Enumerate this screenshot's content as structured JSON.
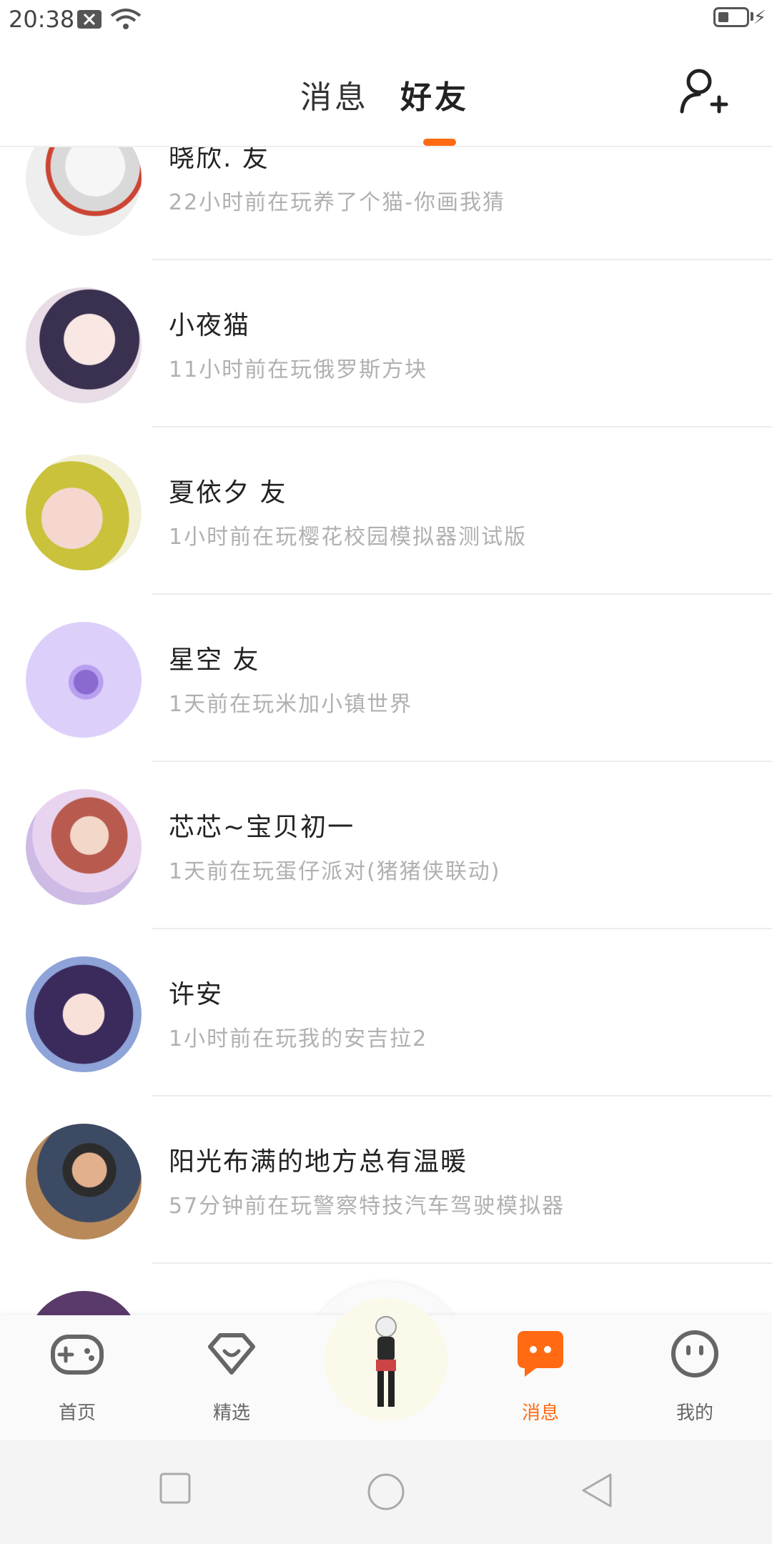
{
  "status_bar": {
    "time": "20:38"
  },
  "header": {
    "tabs": [
      {
        "label": "消息"
      },
      {
        "label": "好友"
      }
    ]
  },
  "friends": [
    {
      "name": "晓欣. 友",
      "status": "22小时前在玩养了个猫-你画我猜"
    },
    {
      "name": "小夜猫",
      "status": "11小时前在玩俄罗斯方块"
    },
    {
      "name": "夏依夕 友",
      "status": "1小时前在玩樱花校园模拟器测试版"
    },
    {
      "name": "星空 友",
      "status": "1天前在玩米加小镇世界"
    },
    {
      "name": "芯芯~宝贝初一",
      "status": "1天前在玩蛋仔派对(猪猪侠联动)"
    },
    {
      "name": "许安",
      "status": "1小时前在玩我的安吉拉2"
    },
    {
      "name": "阳光布满的地方总有温暖",
      "status": "57分钟前在玩警察特技汽车驾驶模拟器"
    },
    {
      "name": "",
      "status": ""
    }
  ],
  "bottom_nav": {
    "items": [
      {
        "label": "首页"
      },
      {
        "label": "精选"
      },
      {
        "label": "消息"
      },
      {
        "label": "我的"
      }
    ],
    "active_color": "#ff6a13"
  }
}
